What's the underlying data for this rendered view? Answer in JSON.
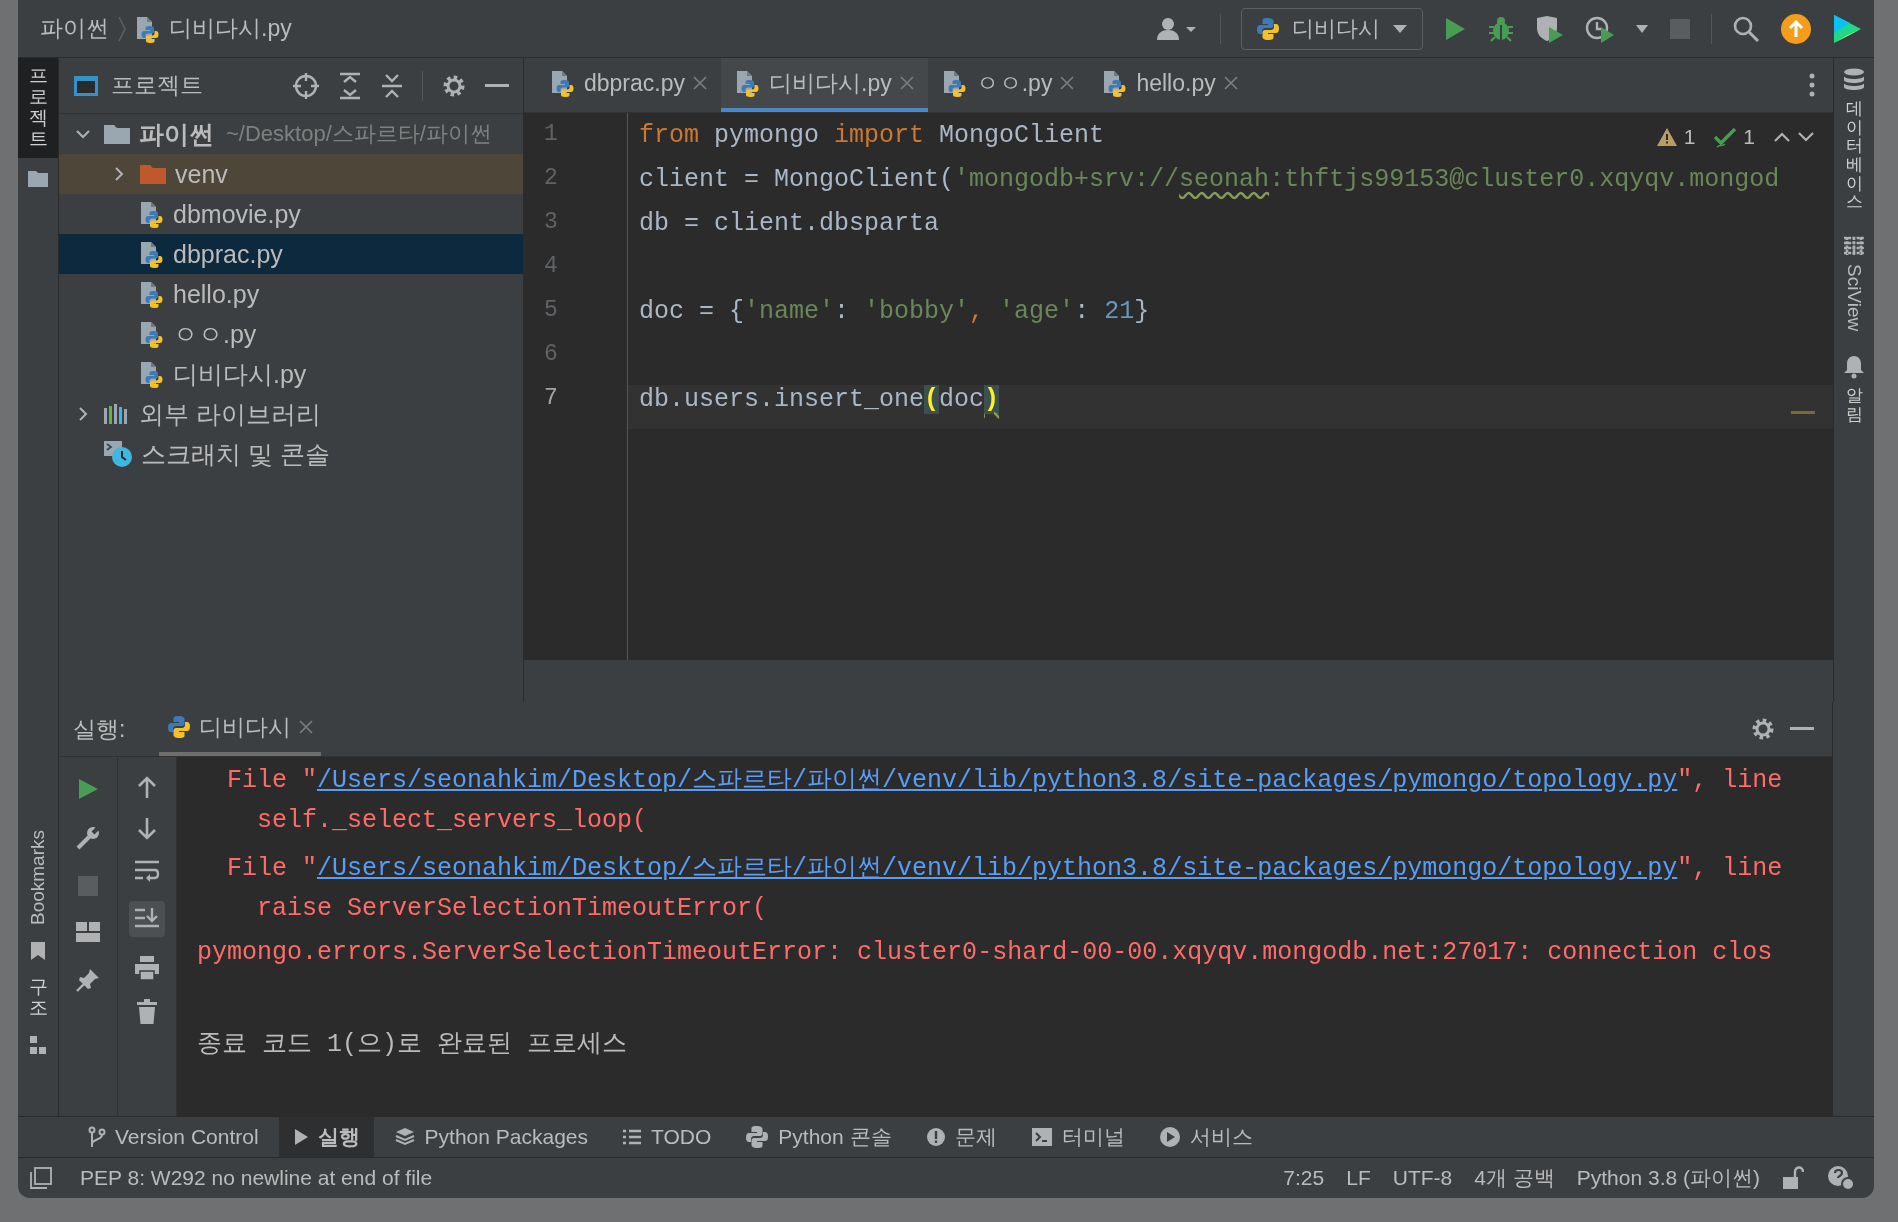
{
  "title_bar": {
    "project": "파이썬",
    "file": "디비다시.py",
    "run_config": "디비다시"
  },
  "left_strip": {
    "top": [
      {
        "label": "프로젝트",
        "selected": true
      }
    ],
    "bottom": [
      {
        "label": "Bookmarks",
        "selected": false
      },
      {
        "label": "구조",
        "selected": false
      }
    ]
  },
  "right_strip": [
    {
      "kind": "database",
      "label": "데이터베이스"
    },
    {
      "kind": "sciview",
      "label": "SciView"
    },
    {
      "kind": "notifications",
      "label": "알림"
    }
  ],
  "project_panel": {
    "title": "프로젝트",
    "tree": [
      {
        "kind": "folder",
        "label": "파이썬",
        "path": "~/Desktop/스파르타/파이썬",
        "expanded": true,
        "selected": false,
        "children": [
          {
            "kind": "excluded-folder",
            "label": "venv",
            "expanded": false,
            "selected": false
          },
          {
            "kind": "python-file",
            "label": "dbmovie.py",
            "selected": false
          },
          {
            "kind": "python-file",
            "label": "dbprac.py",
            "selected": true
          },
          {
            "kind": "python-file",
            "label": "hello.py",
            "selected": false
          },
          {
            "kind": "python-file",
            "label": "ㅇㅇ.py",
            "selected": false
          },
          {
            "kind": "python-file",
            "label": "디비다시.py",
            "selected": false
          }
        ]
      },
      {
        "kind": "libraries",
        "label": "외부 라이브러리",
        "expanded": false,
        "selected": false
      },
      {
        "kind": "scratches",
        "label": "스크래치 및 콘솔",
        "selected": false
      }
    ]
  },
  "tabs": [
    {
      "label": "dbprac.py",
      "selected": false
    },
    {
      "label": "디비다시.py",
      "selected": true
    },
    {
      "label": "ㅇㅇ.py",
      "selected": false
    },
    {
      "label": "hello.py",
      "selected": false
    }
  ],
  "editor": {
    "inspections": {
      "warnings": "1",
      "weak_warnings": "1"
    },
    "lines": [
      {
        "number": "1",
        "current": false,
        "segments": [
          {
            "kind": "keyword",
            "text": "from"
          },
          {
            "kind": "plain",
            "text": " pymongo "
          },
          {
            "kind": "keyword",
            "text": "import"
          },
          {
            "kind": "plain",
            "text": " MongoClient"
          }
        ]
      },
      {
        "number": "2",
        "current": false,
        "segments": [
          {
            "kind": "plain",
            "text": "client = MongoClient("
          },
          {
            "kind": "string",
            "text": "'mongodb+srv://"
          },
          {
            "kind": "string-warn",
            "text": "seonah"
          },
          {
            "kind": "string",
            "text": ":thftjs99153@cluster0.xqyqv.mongod"
          }
        ]
      },
      {
        "number": "3",
        "current": false,
        "segments": [
          {
            "kind": "plain",
            "text": "db = client.dbsparta"
          }
        ]
      },
      {
        "number": "4",
        "current": false
      },
      {
        "number": "5",
        "current": false,
        "segments": [
          {
            "kind": "plain",
            "text": "doc = {"
          },
          {
            "kind": "string",
            "text": "'name'"
          },
          {
            "kind": "plain",
            "text": ": "
          },
          {
            "kind": "string",
            "text": "'bobby'"
          },
          {
            "kind": "keyword",
            "text": ", "
          },
          {
            "kind": "string",
            "text": "'age'"
          },
          {
            "kind": "plain",
            "text": ": "
          },
          {
            "kind": "number",
            "text": "21"
          },
          {
            "kind": "plain",
            "text": "}"
          }
        ]
      },
      {
        "number": "6",
        "current": false
      },
      {
        "number": "7",
        "current": true,
        "segments": [
          {
            "kind": "plain",
            "text": "db.users.insert_one"
          },
          {
            "kind": "brace",
            "text": "("
          },
          {
            "kind": "plain",
            "text": "doc"
          },
          {
            "kind": "brace-warn",
            "text": ")"
          }
        ]
      }
    ]
  },
  "run_panel": {
    "label": "실행:",
    "tab": "디비다시",
    "stop_disabled": true,
    "scroll_to_end_on": true,
    "console": [
      {
        "kind": "file",
        "prefix": "File \"",
        "link": "/Users/seonahkim/Desktop/스파르타/파이썬/venv/lib/python3.8/site-packages/pymongo/topology.py",
        "suffix": "\", line"
      },
      {
        "kind": "code",
        "text": "self._select_servers_loop("
      },
      {
        "kind": "file",
        "prefix": "File \"",
        "link": "/Users/seonahkim/Desktop/스파르타/파이썬/venv/lib/python3.8/site-packages/pymongo/topology.py",
        "suffix": "\", line"
      },
      {
        "kind": "code",
        "text": "raise ServerSelectionTimeoutError("
      },
      {
        "kind": "error",
        "text": "pymongo.errors.ServerSelectionTimeoutError: cluster0-shard-00-00.xqyqv.mongodb.net:27017: connection clos"
      },
      {
        "kind": "exit",
        "text": "종료 코드 1(으)로 완료된 프로세스"
      }
    ]
  },
  "tool_windows": [
    {
      "kind": "vcs",
      "label": "Version Control",
      "selected": false
    },
    {
      "kind": "run",
      "label": "실행",
      "selected": true
    },
    {
      "kind": "packages",
      "label": "Python Packages",
      "selected": false
    },
    {
      "kind": "todo",
      "label": "TODO",
      "selected": false
    },
    {
      "kind": "python-console",
      "label": "Python 콘솔",
      "selected": false
    },
    {
      "kind": "problems",
      "label": "문제",
      "selected": false
    },
    {
      "kind": "terminal",
      "label": "터미널",
      "selected": false
    },
    {
      "kind": "services",
      "label": "서비스",
      "selected": false
    }
  ],
  "status_bar": {
    "message": "PEP 8: W292 no newline at end of file",
    "items": [
      "7:25",
      "LF",
      "UTF-8",
      "4개 공백",
      "Python 3.8 (파이썬)"
    ]
  }
}
